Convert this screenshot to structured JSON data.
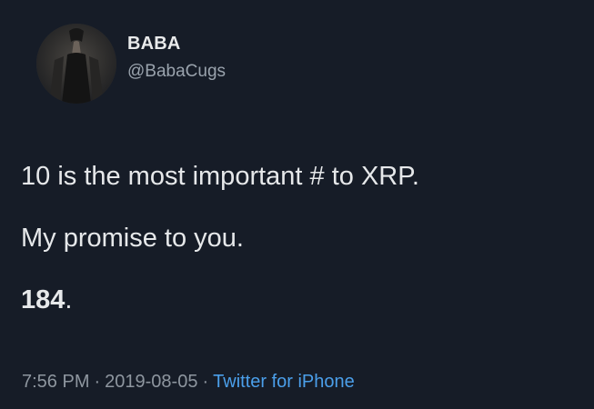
{
  "author": {
    "display_name": "BABA",
    "handle": "@BabaCugs"
  },
  "tweet": {
    "lines": [
      "10 is the most important # to XRP.",
      "My promise to you."
    ],
    "number": "184",
    "number_suffix": "."
  },
  "meta": {
    "time": "7:56 PM",
    "separator": "·",
    "date": "2019-08-05",
    "source": "Twitter for iPhone"
  },
  "colors": {
    "background": "#161c27",
    "source_link": "#4b9fea"
  },
  "icons": {
    "avatar": "profile-photo"
  }
}
